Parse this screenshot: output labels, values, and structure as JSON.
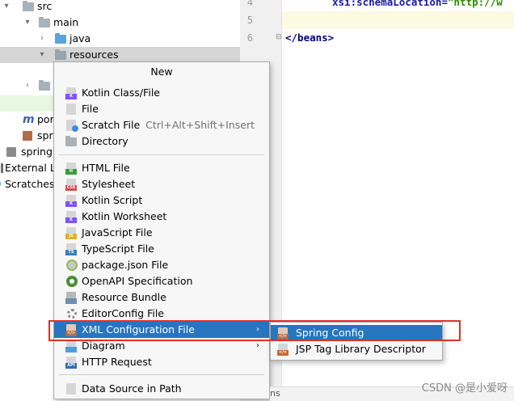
{
  "tree": {
    "rows": [
      {
        "label": "src",
        "arrow": "▾"
      },
      {
        "label": "main",
        "arrow": "▾"
      },
      {
        "label": "java",
        "arrow": "›"
      },
      {
        "label": "resources",
        "arrow": "▾"
      },
      {
        "label": "",
        "arrow": "›"
      },
      {
        "label": "pom",
        "prefix": "m"
      },
      {
        "label": "spr"
      },
      {
        "label": "spring("
      },
      {
        "label": "External Li"
      },
      {
        "label": "Scratches"
      }
    ]
  },
  "editor": {
    "lines": [
      {
        "num": "4",
        "attr": "xsi:schemaLocation",
        "eq": "=",
        "val": "\"http://w"
      },
      {
        "num": "5"
      },
      {
        "num": "6",
        "tag": "</beans>"
      }
    ]
  },
  "popup": {
    "title": "New",
    "items": [
      {
        "label": "Kotlin Class/File"
      },
      {
        "label": "File"
      },
      {
        "label": "Scratch File",
        "shortcut": "Ctrl+Alt+Shift+Insert"
      },
      {
        "label": "Directory"
      },
      {
        "label": "HTML File"
      },
      {
        "label": "Stylesheet"
      },
      {
        "label": "Kotlin Script"
      },
      {
        "label": "Kotlin Worksheet"
      },
      {
        "label": "JavaScript File"
      },
      {
        "label": "TypeScript File"
      },
      {
        "label": "package.json File"
      },
      {
        "label": "OpenAPI Specification"
      },
      {
        "label": "Resource Bundle"
      },
      {
        "label": "EditorConfig File"
      },
      {
        "label": "XML Configuration File",
        "submenu": "›"
      },
      {
        "label": "Diagram",
        "submenu": "›"
      },
      {
        "label": "HTTP Request"
      },
      {
        "label": "Data Source in Path"
      }
    ]
  },
  "submenu": {
    "items": [
      {
        "label": "Spring Config"
      },
      {
        "label": "JSP Tag Library Descriptor"
      }
    ]
  },
  "statusbar": {
    "text": "ns"
  },
  "watermark": "CSDN @是小爱呀",
  "colors": {
    "selection": "#2675bf",
    "annotation": "#e0302a"
  }
}
